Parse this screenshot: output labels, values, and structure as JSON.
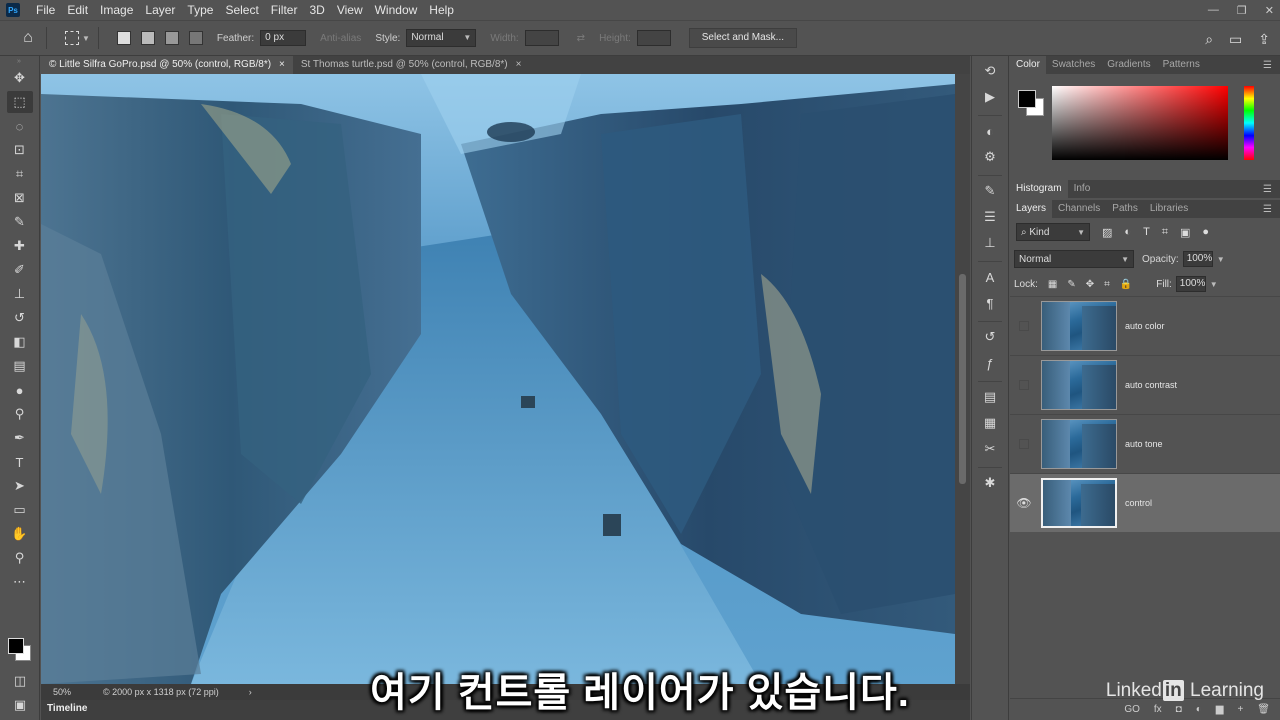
{
  "menu": {
    "logo": "Ps",
    "items": [
      "File",
      "Edit",
      "Image",
      "Layer",
      "Type",
      "Select",
      "Filter",
      "3D",
      "View",
      "Window",
      "Help"
    ],
    "window_controls": [
      "—",
      "❐",
      "✕"
    ]
  },
  "options_bar": {
    "feather_label": "Feather:",
    "feather_value": "0 px",
    "anti_alias_label": "Anti-alias",
    "style_label": "Style:",
    "style_value": "Normal",
    "width_label": "Width:",
    "height_label": "Height:",
    "select_and_mask_label": "Select and Mask..."
  },
  "tabs": [
    {
      "label": "© Little Silfra GoPro.psd @ 50% (control, RGB/8*)",
      "close": "×"
    },
    {
      "label": "St Thomas turtle.psd @ 50% (control, RGB/8*)",
      "close": "×"
    }
  ],
  "status": {
    "zoom": "50%",
    "doc_info": "© 2000 px x 1318 px (72 ppi)",
    "arrow": "›"
  },
  "timeline_label": "Timeline",
  "subtitle": "여기 컨트롤 레이어가 있습니다.",
  "watermark": {
    "pre": "Linked",
    "in": "in",
    "post": " Learning"
  },
  "color_panel": {
    "tabs": [
      "Color",
      "Swatches",
      "Gradients",
      "Patterns"
    ],
    "foreground": "#000000",
    "background": "#ffffff"
  },
  "histogram_panel": {
    "tabs": [
      "Histogram",
      "Info"
    ]
  },
  "layers_panel": {
    "tabs": [
      "Layers",
      "Channels",
      "Paths",
      "Libraries"
    ],
    "kind_label": "Kind",
    "blend_mode": "Normal",
    "opacity_label": "Opacity:",
    "opacity_value": "100%",
    "lock_label": "Lock:",
    "fill_label": "Fill:",
    "fill_value": "100%",
    "layers": [
      {
        "name": "auto color",
        "visible": false,
        "selected": false
      },
      {
        "name": "auto contrast",
        "visible": false,
        "selected": false
      },
      {
        "name": "auto tone",
        "visible": false,
        "selected": false
      },
      {
        "name": "control",
        "visible": true,
        "selected": true
      }
    ],
    "footer": [
      "GO",
      "fx",
      "◘",
      "◐",
      "▆",
      "+",
      "🗑"
    ]
  },
  "accent_colors": {
    "water_light": "#6fb0dc",
    "water_dark": "#1f4f75",
    "ui_bg": "#535353"
  }
}
